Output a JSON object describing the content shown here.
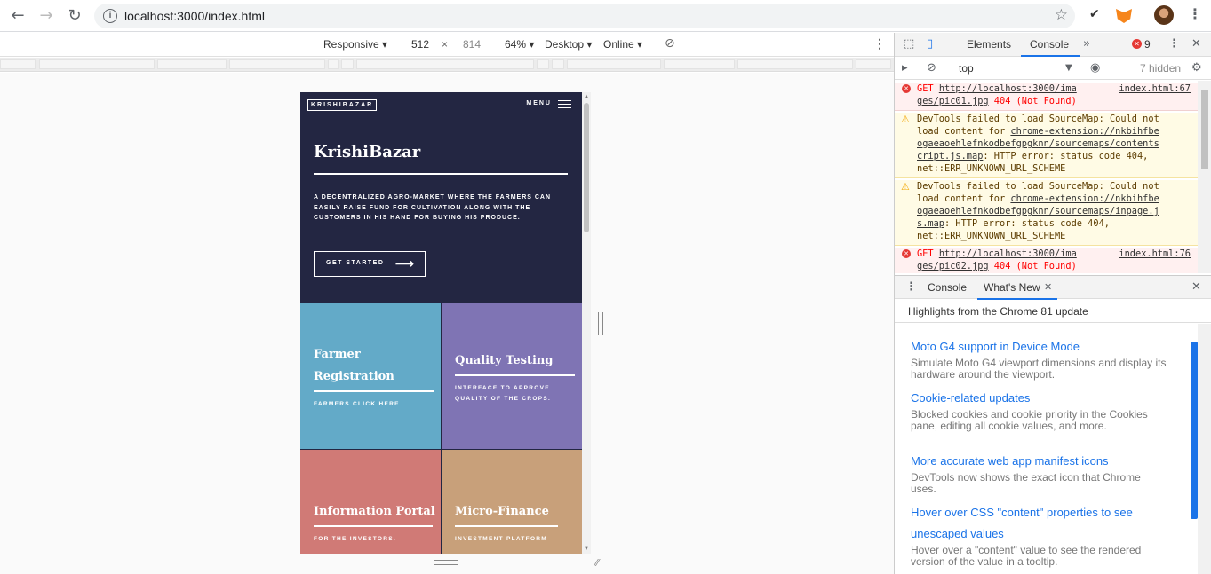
{
  "browser": {
    "url": "localhost:3000/index.html"
  },
  "device_toolbar": {
    "device": "Responsive",
    "width": "512",
    "separator": "×",
    "height": "814",
    "zoom": "64%",
    "mode": "Desktop",
    "network": "Online"
  },
  "site": {
    "brand": "KRISHIBAZAR",
    "menu_label": "MENU",
    "hero_title": "KrishiBazar",
    "hero_text": "A DECENTRALIZED AGRO-MARKET WHERE THE FARMERS CAN EASILY RAISE FUND FOR CULTIVATION ALONG WITH THE CUSTOMERS IN HIS HAND FOR BUYING HIS PRODUCE.",
    "cta": "GET STARTED",
    "tiles": [
      {
        "title_line1": "Farmer",
        "title_line2": "Registration",
        "subtitle": "FARMERS CLICK HERE."
      },
      {
        "title_line1": "Quality Testing",
        "subtitle": "INTERFACE TO APPROVE QUALITY OF THE CROPS."
      },
      {
        "title_line1": "Information Portal",
        "subtitle": "FOR THE INVESTORS."
      },
      {
        "title_line1": "Micro-Finance",
        "subtitle": "INVESTMENT PLATFORM"
      }
    ],
    "colors": {
      "hero_bg": "#232642",
      "tile1": "#63aac8",
      "tile2": "#7f74b4",
      "tile3": "#d07a76",
      "tile4": "#c8a07a"
    }
  },
  "devtools": {
    "tabs": [
      "Elements",
      "Console"
    ],
    "active_tab": "Console",
    "error_count": "9",
    "context": "top",
    "hidden": "7 hidden",
    "messages": [
      {
        "type": "error",
        "prefix": "GET ",
        "link": "http://localhost:3000/ima",
        "link2": "ges/pic01.jpg",
        "status": " 404 (Not Found)",
        "source": "index.html:67"
      },
      {
        "type": "warning",
        "line1": "DevTools failed to load SourceMap: Could not",
        "line2a": "load content for ",
        "link": "chrome-extension://nkbihfbe",
        "link2": "ogaeaoehlefnkodbefgpgknn/sourcemaps/contents",
        "link3": "cript.js.map",
        "rest3": ": HTTP error: status code 404,",
        "line4": "net::ERR_UNKNOWN_URL_SCHEME"
      },
      {
        "type": "warning",
        "line1": "DevTools failed to load SourceMap: Could not",
        "line2a": "load content for ",
        "link": "chrome-extension://nkbihfbe",
        "link2": "ogaeaoehlefnkodbefgpgknn/sourcemaps/inpage.j",
        "link3": "s.map",
        "rest3": ": HTTP error: status code 404,",
        "line4": "net::ERR_UNKNOWN_URL_SCHEME"
      },
      {
        "type": "error",
        "prefix": "GET ",
        "link": "http://localhost:3000/ima",
        "link2": "ges/pic02.jpg",
        "status": " 404 (Not Found)",
        "source": "index.html:76"
      }
    ],
    "drawer_tabs": [
      "Console",
      "What's New"
    ],
    "drawer_active": "What's New",
    "highlights": "Highlights from the Chrome 81 update",
    "news": [
      {
        "title": "Moto G4 support in Device Mode",
        "desc": "Simulate Moto G4 viewport dimensions and display its hardware around the viewport."
      },
      {
        "title": "Cookie-related updates",
        "desc": "Blocked cookies and cookie priority in the Cookies pane, editing all cookie values, and more."
      },
      {
        "title": "More accurate web app manifest icons",
        "desc": "DevTools now shows the exact icon that Chrome uses."
      },
      {
        "title": "Hover over CSS \"content\" properties to see unescaped values",
        "desc": "Hover over a \"content\" value to see the rendered version of the value in a tooltip."
      }
    ]
  }
}
